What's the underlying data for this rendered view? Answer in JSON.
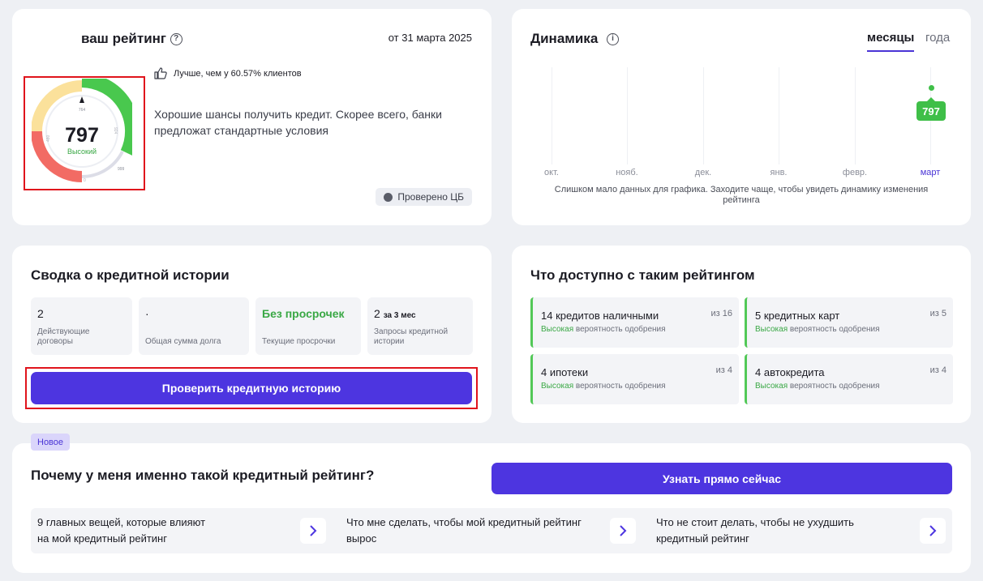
{
  "rating": {
    "title": "ваш рейтинг",
    "date": "от 31 марта 2025",
    "score": "797",
    "level": "Высокий",
    "better_than": "Лучше, чем у 60.57% клиентов",
    "description_1": "Хорошие шансы получить кредит. Скорее всего, банки",
    "description_2": "предложат стандартные условия",
    "verified": "Проверено ЦБ",
    "gauge_label_top": "764",
    "gauge_label_left": "480",
    "gauge_label_right": "924",
    "gauge_label_bottom_right": "999",
    "gauge_label_bottom": "0",
    "score_fraction": 0.797,
    "colors": {
      "green": "#49c84e",
      "yellow": "#fbe19b",
      "red": "#f26b64",
      "grey": "#dcdde7"
    }
  },
  "dynamics": {
    "title": "Динамика",
    "tabs": [
      {
        "label": "месяцы",
        "active": true
      },
      {
        "label": "года",
        "active": false
      }
    ],
    "months": [
      "окт.",
      "нояб.",
      "дек.",
      "янв.",
      "февр.",
      "март"
    ],
    "current_score": "797",
    "note_1": "Слишком мало данных для графика. Заходите чаще, чтобы увидеть динамику изменения",
    "note_2": "рейтинга"
  },
  "history": {
    "title": "Сводка о кредитной истории",
    "stats": [
      {
        "value": "2",
        "suffix": "",
        "label": "Действующие договоры"
      },
      {
        "value": "·",
        "suffix": "",
        "label": "Общая сумма долга"
      },
      {
        "value": "Без просрочек",
        "suffix": "",
        "label": "Текущие просрочки"
      },
      {
        "value": "2",
        "suffix": "за 3 мес",
        "label": "Запросы кредитной истории"
      }
    ],
    "button": "Проверить кредитную историю"
  },
  "available": {
    "title": "Что доступно с таким рейтингом",
    "offers": [
      {
        "title": "14 кредитов наличными",
        "of": "из 16",
        "prob_hi": "Высокая",
        "prob_rest": "вероятность одобрения"
      },
      {
        "title": "5 кредитных карт",
        "of": "из 5",
        "prob_hi": "Высокая",
        "prob_rest": "вероятность одобрения"
      },
      {
        "title": "4 ипотеки",
        "of": "из 4",
        "prob_hi": "Высокая",
        "prob_rest": "вероятность одобрения"
      },
      {
        "title": "4 автокредита",
        "of": "из 4",
        "prob_hi": "Высокая",
        "prob_rest": "вероятность одобрения"
      }
    ]
  },
  "why": {
    "badge": "Новое",
    "title": "Почему у меня именно такой кредитный рейтинг?",
    "button": "Узнать прямо сейчас",
    "links": [
      {
        "line1": "9 главных вещей, которые влияют",
        "line2": "на мой кредитный рейтинг"
      },
      {
        "line1": "Что мне сделать, чтобы мой кредитный рейтинг",
        "line2": "вырос"
      },
      {
        "line1": "Что не стоит делать, чтобы не ухудшить",
        "line2": "кредитный рейтинг"
      }
    ]
  }
}
